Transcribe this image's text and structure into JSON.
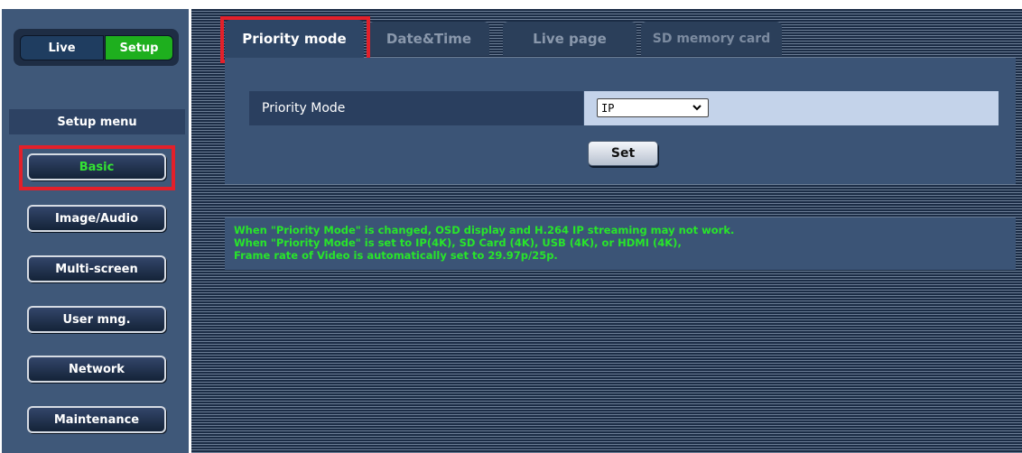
{
  "nav": {
    "live_label": "Live",
    "setup_label": "Setup"
  },
  "setup_menu": {
    "heading": "Setup menu",
    "items": [
      {
        "label": "Basic",
        "active": true
      },
      {
        "label": "Image/Audio",
        "active": false
      },
      {
        "label": "Multi-screen",
        "active": false
      },
      {
        "label": "User mng.",
        "active": false
      },
      {
        "label": "Network",
        "active": false
      },
      {
        "label": "Maintenance",
        "active": false
      }
    ]
  },
  "tabs": [
    {
      "label": "Priority mode",
      "active": true
    },
    {
      "label": "Date&Time",
      "active": false
    },
    {
      "label": "Live page",
      "active": false
    },
    {
      "label": "SD memory card",
      "active": false
    }
  ],
  "priority_mode": {
    "label": "Priority Mode",
    "selected_value": "IP",
    "set_button": "Set"
  },
  "notice": {
    "lines": [
      "When \"Priority Mode\" is changed, OSD display and H.264 IP streaming may not work.",
      "When \"Priority Mode\" is set to IP(4K), SD Card (4K), USB (4K), or HDMI (4K),",
      "Frame rate of Video is automatically set to 29.97p/25p."
    ]
  },
  "colors": {
    "accent_green": "#1eaf1e",
    "notice_text": "#28e52a",
    "highlight_red": "#e3202a",
    "panel_blue": "#3b5476"
  },
  "icons": {
    "dropdown": "chevron-down-icon"
  }
}
